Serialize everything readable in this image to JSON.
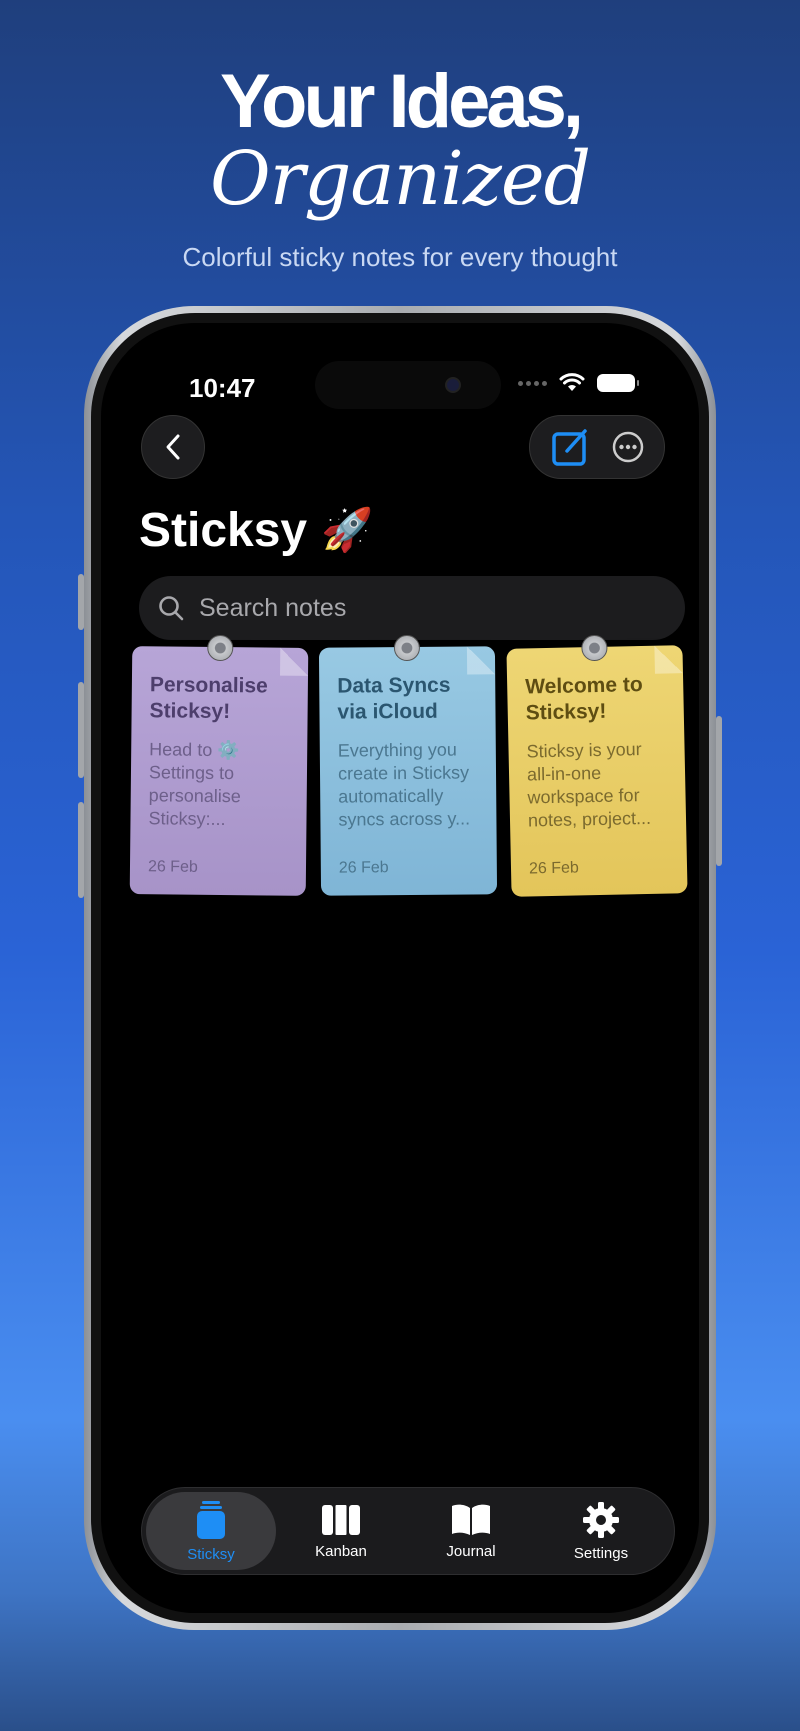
{
  "headline": {
    "line1": "Your Ideas,",
    "line2": "Organized",
    "subtitle": "Colorful sticky notes for every thought"
  },
  "status_bar": {
    "time": "10:47"
  },
  "app": {
    "title": "Sticksy",
    "title_emoji": "🚀",
    "search_placeholder": "Search notes"
  },
  "notes": [
    {
      "title": "Personalise Sticksy!",
      "body": "Head to ⚙️ Settings to personalise Sticksy:...",
      "date": "26 Feb",
      "color": "#b7a5d7"
    },
    {
      "title": "Data Syncs via iCloud",
      "body": "Everything you create in Sticksy automatically syncs across y...",
      "date": "26 Feb",
      "color": "#98c9e3"
    },
    {
      "title": "Welcome to Sticksy!",
      "body": "Sticksy is your all-in-one workspace for notes, project...",
      "date": "26 Feb",
      "color": "#eed674"
    }
  ],
  "tabs": [
    {
      "label": "Sticksy",
      "icon": "sticky-note-icon",
      "active": true
    },
    {
      "label": "Kanban",
      "icon": "kanban-icon",
      "active": false
    },
    {
      "label": "Journal",
      "icon": "book-icon",
      "active": false
    },
    {
      "label": "Settings",
      "icon": "gear-icon",
      "active": false
    }
  ],
  "colors": {
    "accent": "#1e8ef5",
    "background_top": "#1f3f7d",
    "background_bottom": "#4a8ef0"
  }
}
